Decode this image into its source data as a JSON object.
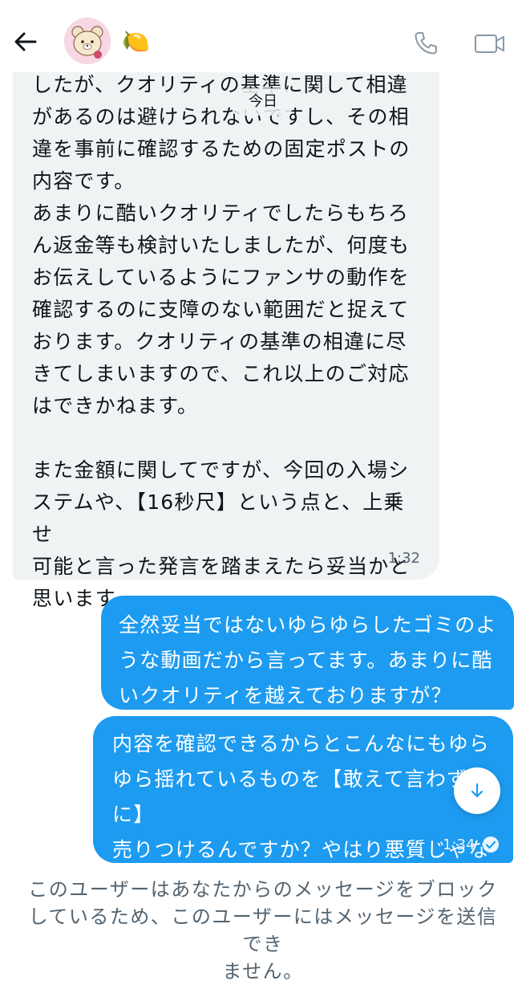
{
  "header": {
    "contact_emoji": "🍋",
    "icons": [
      "back-arrow-icon",
      "phone-icon",
      "video-camera-icon"
    ]
  },
  "conversation": {
    "date_label": "今日",
    "incoming": {
      "text": "したが、クオリティの基準に関して相違\nがあるのは避けられないですし、その相\n違を事前に確認するための固定ポストの\n内容です。\nあまりに酷いクオリティでしたらもちろ\nん返金等も検討いたしましたが、何度も\nお伝えしているようにファンサの動作を\n確認するのに支障のない範囲だと捉えて\nおります。クオリティの基準の相違に尽\nきてしまいますので、これ以上のご対応\nはできかねます。\n\nまた金額に関してですが、今回の入場シ\nステムや、【16秒尺】という点と、上乗せ\n可能と言った発言を踏まえたら妥当かと\n思います。",
      "time": "1:32"
    },
    "outgoing": [
      {
        "text": "全然妥当ではないゆらゆらしたゴミのよ\nうな動画だから言ってます。あまりに酷\nいクオリティを越えておりますが？"
      },
      {
        "text": "内容を確認できるからとこんなにもゆら\nゆら揺れているものを【敢えて言わずに】\n売りつけるんですか？やはり悪質じゃな\nいですか",
        "time": "1:34"
      }
    ]
  },
  "footer": {
    "blocked_notice": "このユーザーはあなたからのメッセージをブロック\nしているため、このユーザーにはメッセージを送信でき\nません。"
  },
  "colors": {
    "accent": "#1d9bf0",
    "incoming_bubble": "#eff3f4",
    "muted_text": "#536471"
  }
}
